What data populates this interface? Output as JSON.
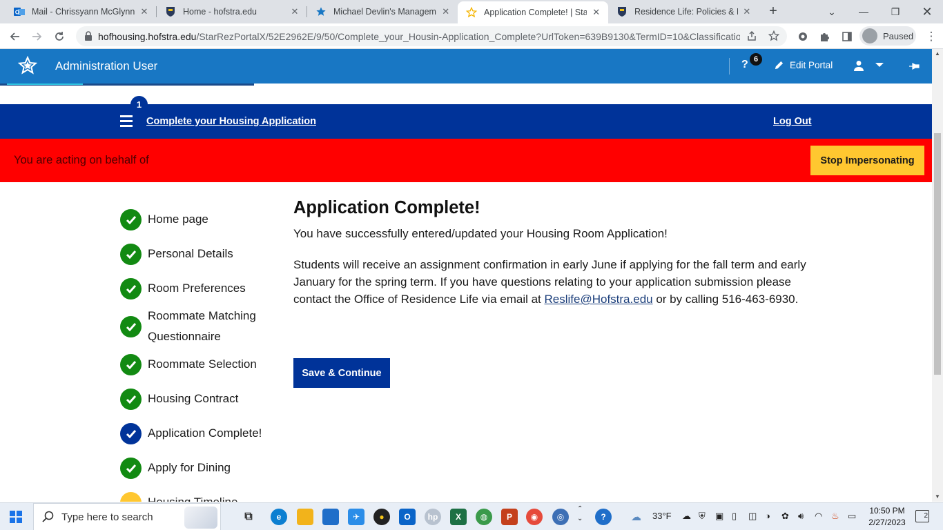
{
  "browser": {
    "tabs": [
      {
        "title": "Mail - Chrissyann McGlynn - O",
        "icon": "outlook-icon"
      },
      {
        "title": "Home - hofstra.edu",
        "icon": "hofstra-shield-icon"
      },
      {
        "title": "Michael Devlin's Managemen",
        "icon": "starrez-star-icon"
      },
      {
        "title": "Application Complete! | StarR",
        "icon": "star-outline-icon"
      },
      {
        "title": "Residence Life: Policies & Pro",
        "icon": "hofstra-shield-icon"
      }
    ],
    "url_host": "hofhousing.hofstra.edu",
    "url_path": "/StarRezPortalX/52E2962E/9/50/Complete_your_Housin-Application_Complete?UrlToken=639B9130&TermID=10&Classificatio...",
    "profile_label": "Paused"
  },
  "admin_bar": {
    "title": "Administration User",
    "help_badge": "6",
    "help_label": "?",
    "edit_label": "Edit Portal"
  },
  "portal_nav": {
    "step_count": "1",
    "breadcrumb": "Complete your Housing Application",
    "logout": "Log Out"
  },
  "impersonation": {
    "message": "You are acting on behalf of",
    "stop_label": "Stop Impersonating"
  },
  "steps": [
    {
      "label": "Home page",
      "status": "done"
    },
    {
      "label": "Personal Details",
      "status": "done"
    },
    {
      "label": "Room Preferences",
      "status": "done"
    },
    {
      "label": "Roommate Matching Questionnaire",
      "status": "done"
    },
    {
      "label": "Roommate Selection",
      "status": "done"
    },
    {
      "label": "Housing Contract",
      "status": "done"
    },
    {
      "label": "Application Complete!",
      "status": "current"
    },
    {
      "label": "Apply for Dining",
      "status": "done"
    },
    {
      "label": "Housing Timeline",
      "status": "pending"
    }
  ],
  "content": {
    "heading": "Application Complete!",
    "para1": "You have successfully entered/updated your Housing Room Application!",
    "para2_a": "Students will receive an assignment confirmation in early June if applying for the fall term and early January for the spring term. If you have questions relating to your application submission please contact the Office of Residence Life via email at ",
    "email": "Reslife@Hofstra.edu",
    "para2_b": " or by calling 516-463-6930.",
    "save_label": "Save & Continue"
  },
  "taskbar": {
    "search_placeholder": "Type here to search",
    "weather": "33°F",
    "time": "10:50 PM",
    "date": "2/27/2023",
    "notifications": "2"
  },
  "colors": {
    "admin_blue": "#1877c4",
    "portal_navy": "#003399",
    "alert_red": "#ff0000",
    "accent_yellow": "#ffc730",
    "done_green": "#128a12"
  }
}
